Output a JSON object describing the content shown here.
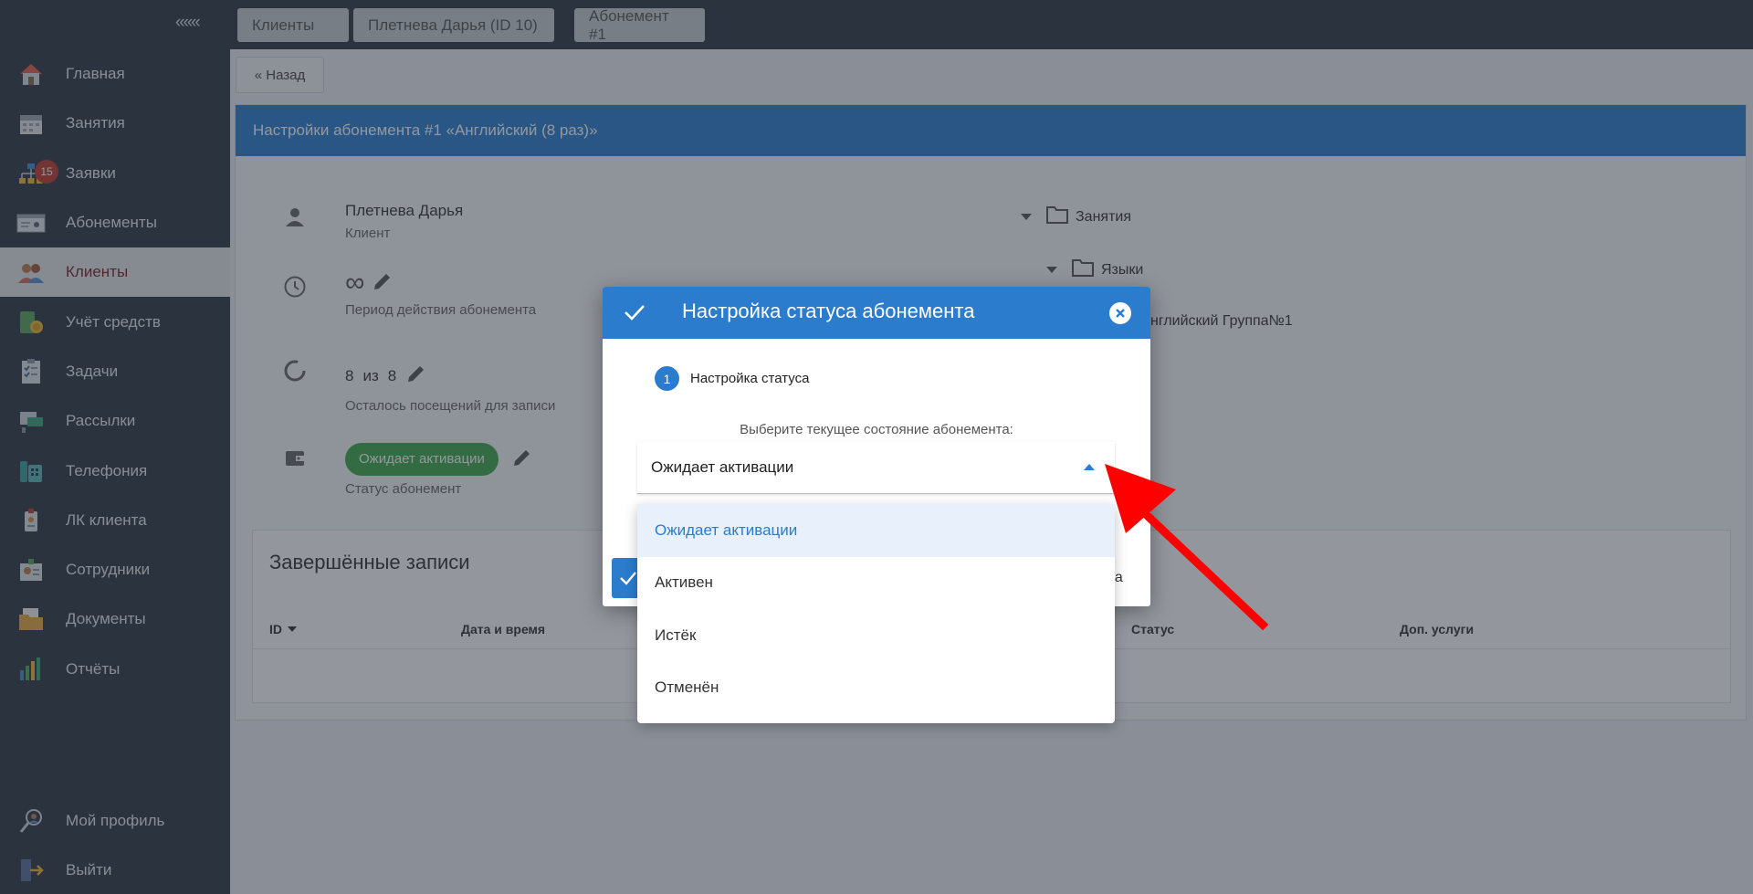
{
  "sidebar": {
    "collapse_label": "«««",
    "items": [
      {
        "label": "Главная",
        "icon": "house-icon"
      },
      {
        "label": "Занятия",
        "icon": "calendar-icon"
      },
      {
        "label": "Заявки",
        "icon": "org-chart-icon",
        "badge": "15"
      },
      {
        "label": "Абонементы",
        "icon": "id-card-icon"
      },
      {
        "label": "Клиенты",
        "icon": "clients-icon",
        "active": true
      },
      {
        "label": "Учёт средств",
        "icon": "money-icon"
      },
      {
        "label": "Задачи",
        "icon": "checklist-icon"
      },
      {
        "label": "Рассылки",
        "icon": "mailing-icon"
      },
      {
        "label": "Телефония",
        "icon": "phone-icon"
      },
      {
        "label": "ЛК клиента",
        "icon": "badge-icon"
      },
      {
        "label": "Сотрудники",
        "icon": "staff-icon"
      },
      {
        "label": "Документы",
        "icon": "folder-docs-icon"
      },
      {
        "label": "Отчёты",
        "icon": "bar-chart-icon"
      }
    ],
    "bottom": [
      {
        "label": "Мой профиль",
        "icon": "profile-icon"
      },
      {
        "label": "Выйти",
        "icon": "logout-icon"
      }
    ]
  },
  "breadcrumbs": [
    "Клиенты",
    "Плетнева Дарья (ID 10)",
    "Абонемент #1"
  ],
  "back_label": "« Назад",
  "panel": {
    "title": "Настройки абонемента #1 «Английский (8 раз)»",
    "client_name": "Плетнева Дарья",
    "client_role": "Клиент",
    "period_value": "∞",
    "period_label": "Период действия абонемента",
    "visits_left": "8",
    "visits_of": "из",
    "visits_total": "8",
    "visits_label": "Осталось посещений для записи",
    "status_value": "Ожидает активации",
    "status_label": "Статус абонемент",
    "tree": {
      "level1": "Занятия",
      "level2": "Языки",
      "level3": "нглийский Группа№1"
    }
  },
  "records": {
    "title": "Завершённые записи",
    "columns": [
      "ID",
      "Дата и время",
      "Статус",
      "Доп. услуги"
    ]
  },
  "modal": {
    "title": "Настройка статуса абонемента",
    "step_number": "1",
    "step_label": "Настройка статуса",
    "field_label": "Выберите текущее состояние абонемента:",
    "selected": "Ожидает активации",
    "options": [
      "Ожидает активации",
      "Активен",
      "Истёк",
      "Отменён"
    ],
    "cancel_fragment": "на"
  },
  "colors": {
    "sidebar_bg": "#2c3640",
    "primary": "#2b7ccd",
    "status_green": "#3ea84a",
    "annotation_arrow": "#ff0000"
  }
}
